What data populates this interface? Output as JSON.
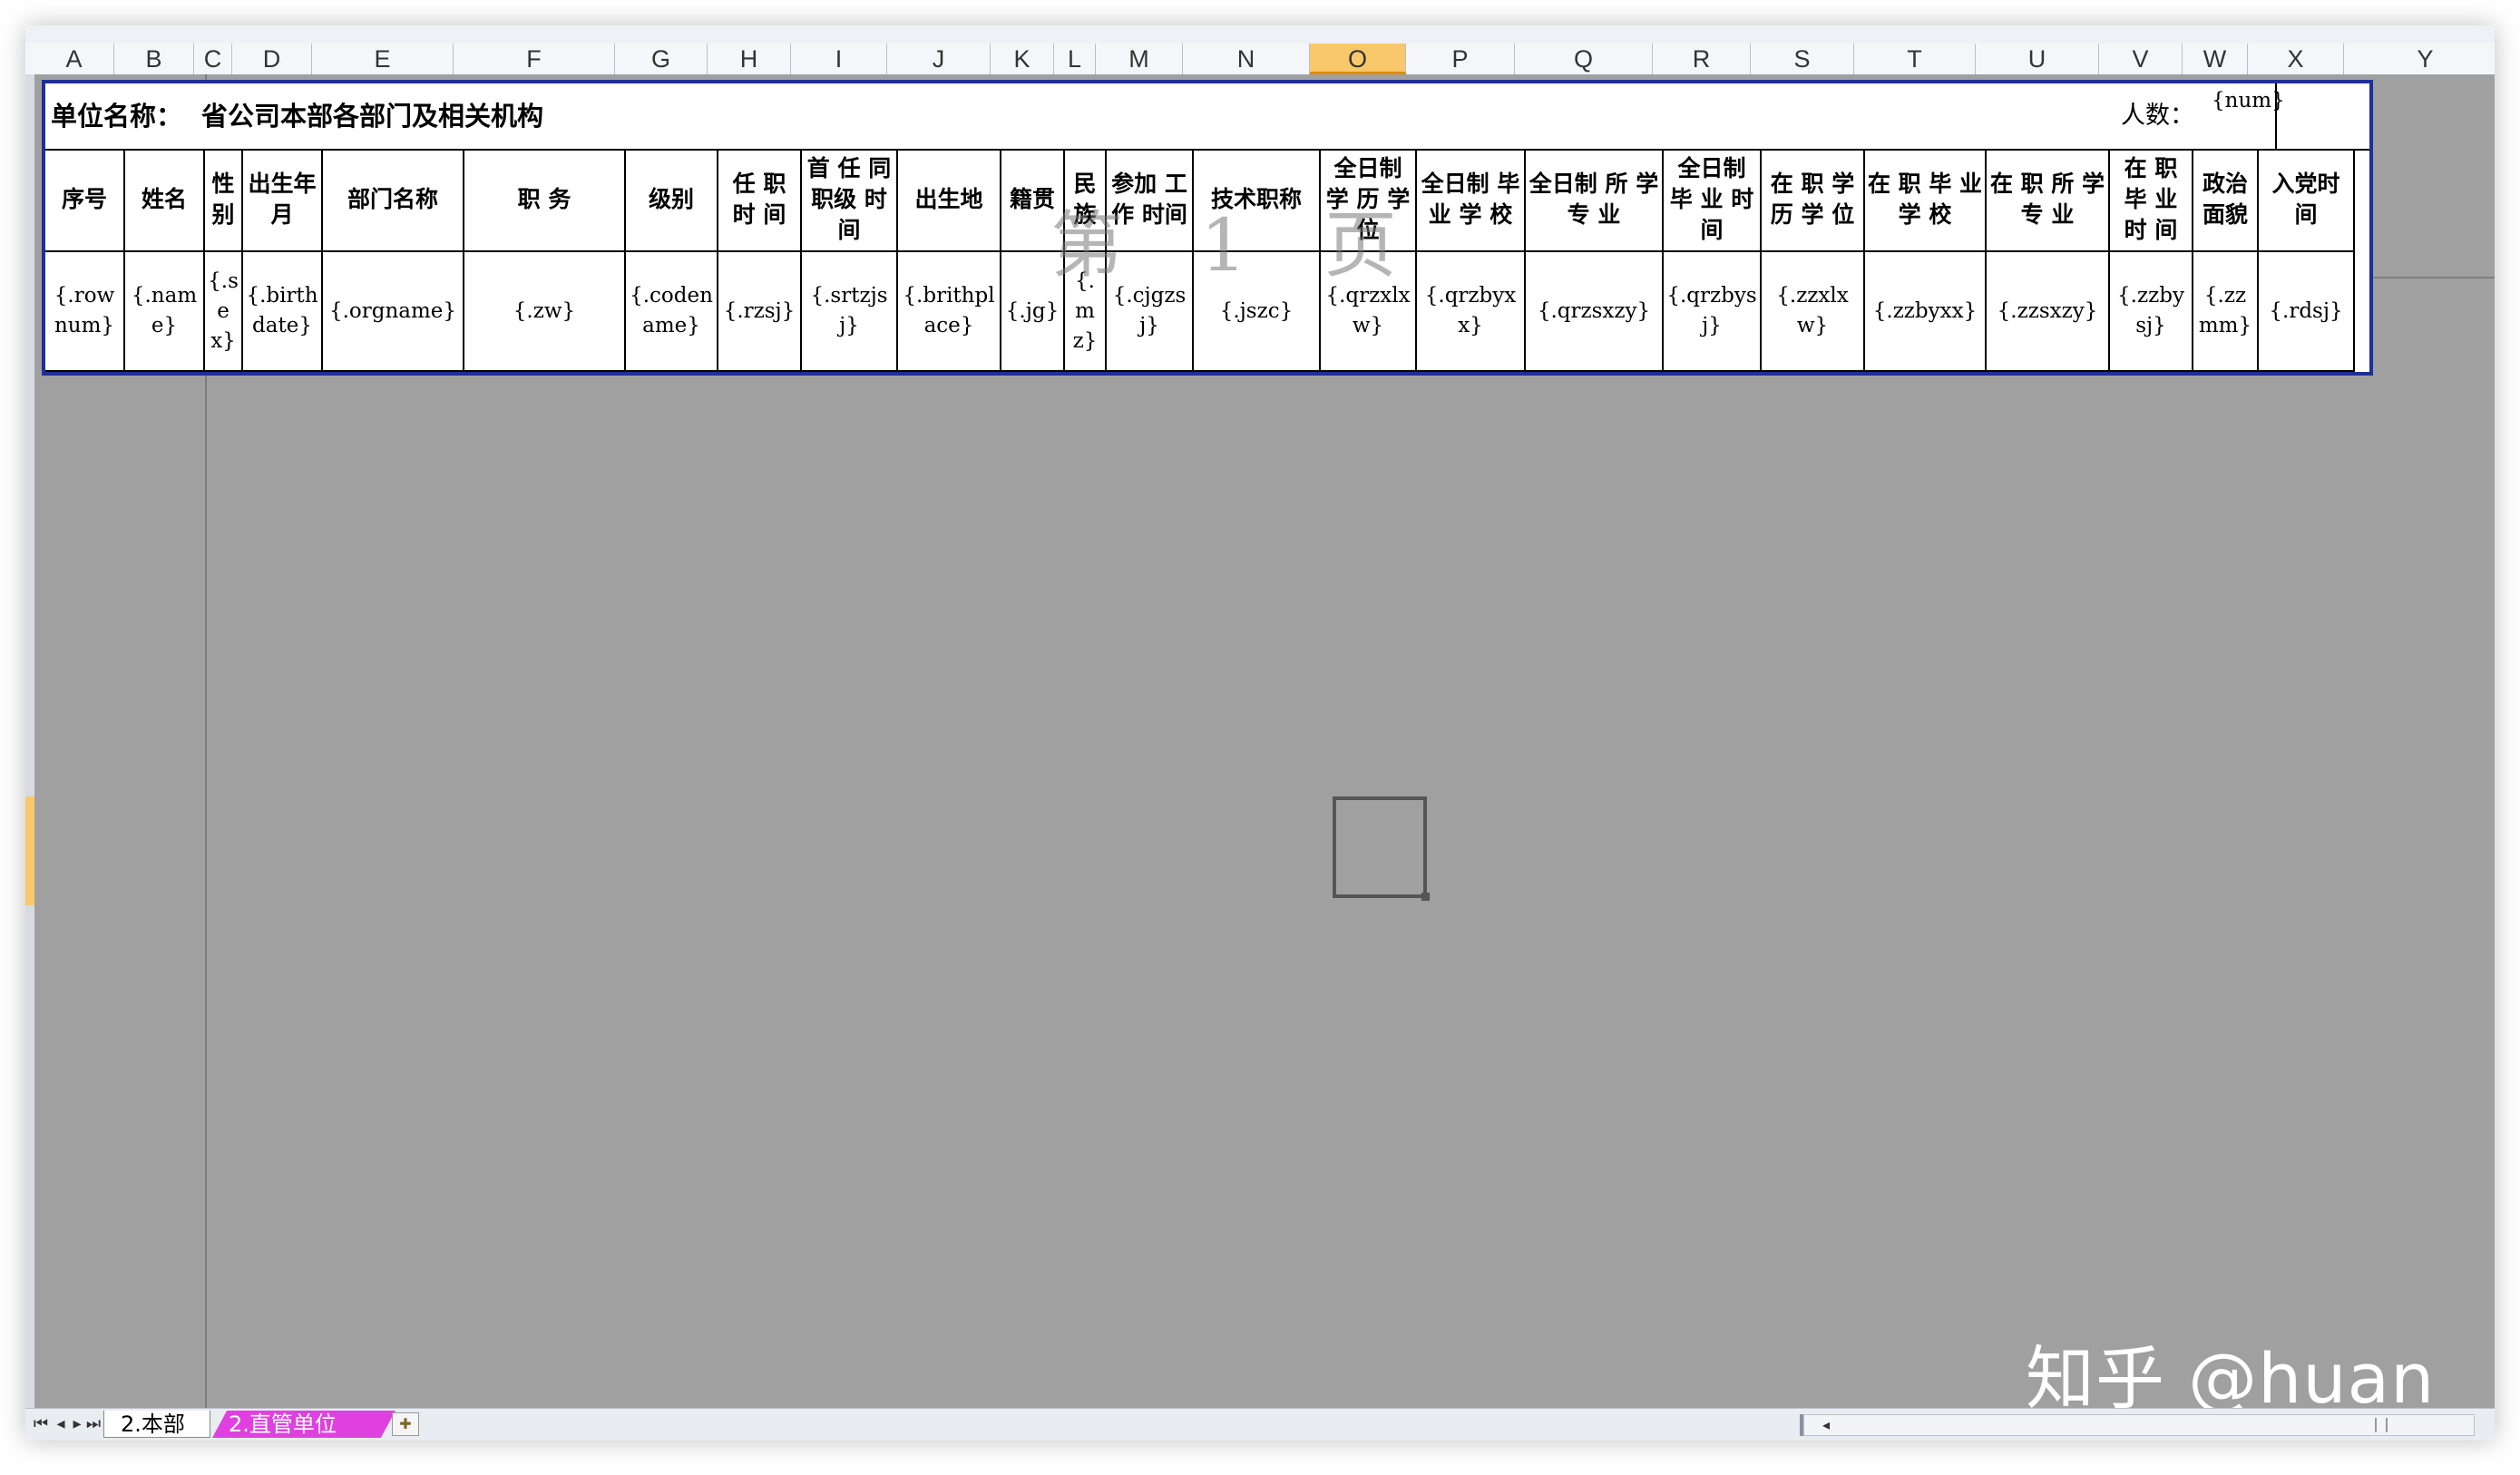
{
  "columns": [
    "A",
    "B",
    "C",
    "D",
    "E",
    "F",
    "G",
    "H",
    "I",
    "J",
    "K",
    "L",
    "M",
    "N",
    "O",
    "P",
    "Q",
    "R",
    "S",
    "T",
    "U",
    "V",
    "W",
    "X",
    "Y"
  ],
  "active_column": "O",
  "unit_row": {
    "label": "单位名称：",
    "value": "省公司本部各部门及相关机构",
    "count_label": "人数：",
    "count_value": "{num}"
  },
  "headers": [
    "序号",
    "姓名",
    "性别",
    "出生年月",
    "部门名称",
    "职 务",
    "级别",
    "任 职 时 间",
    "首 任 同职级 时 间",
    "出生地",
    "籍贯",
    "民族",
    "参加 工作 时间",
    "技术职称",
    "全日制 学 历 学 位",
    "全日制 毕 业 学 校",
    "全日制 所 学 专 业",
    "全日制 毕 业 时 间",
    "在 职 学 历 学 位",
    "在 职 毕 业 学 校",
    "在 职 所 学 专 业",
    "在 职 毕 业 时 间",
    "政治 面貌",
    "入党时 间"
  ],
  "fields": [
    "{.rownum}",
    "{.name}",
    "{.sex}",
    "{.birthdate}",
    "{.orgname}",
    "{.zw}",
    "{.codename}",
    "{.rzsj}",
    "{.srtzjsj}",
    "{.brithplace}",
    "{.jg}",
    "{.mz}",
    "{.cjgzsj}",
    "{.jszc}",
    "{.qrzxlxw}",
    "{.qrzbyxx}",
    "{.qrzsxzy}",
    "{.qrzbysj}",
    "{.zzxlxw}",
    "{.zzbyxx}",
    "{.zzsxzy}",
    "{.zzbysj}",
    "{.zzmm}",
    "{.rdsj}"
  ],
  "watermark": "第 1 页",
  "sheet_tabs": [
    "2.本部",
    "2.直管单位"
  ],
  "active_tab": "2.本部",
  "brand_watermark": "知乎 @huan",
  "colors": {
    "active_col": "#f8c86a",
    "table_border": "#1f2f9a",
    "tab2": "#e040e0",
    "sheet_bg": "#a0a0a0"
  }
}
